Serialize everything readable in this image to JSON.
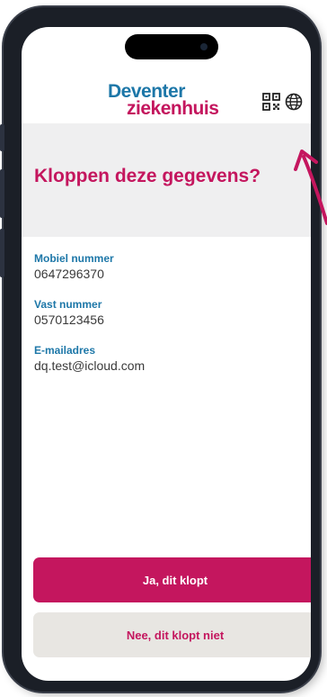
{
  "header": {
    "logo_line1": "Deventer",
    "logo_line2": "ziekenhuis",
    "qr_icon": "qr-code-icon",
    "language_icon": "globe-icon"
  },
  "page": {
    "title": "Kloppen deze gegevens?"
  },
  "fields": [
    {
      "label": "Mobiel nummer",
      "value": "0647296370"
    },
    {
      "label": "Vast nummer",
      "value": "0570123456"
    },
    {
      "label": "E-mailadres",
      "value": "dq.test@icloud.com"
    }
  ],
  "actions": {
    "confirm_label": "Ja, dit klopt",
    "reject_label": "Nee, dit klopt niet"
  },
  "colors": {
    "brand_pink": "#c4165e",
    "brand_blue": "#1d77a8",
    "band_gray": "#efeff0",
    "secondary_button": "#e8e6e2"
  }
}
